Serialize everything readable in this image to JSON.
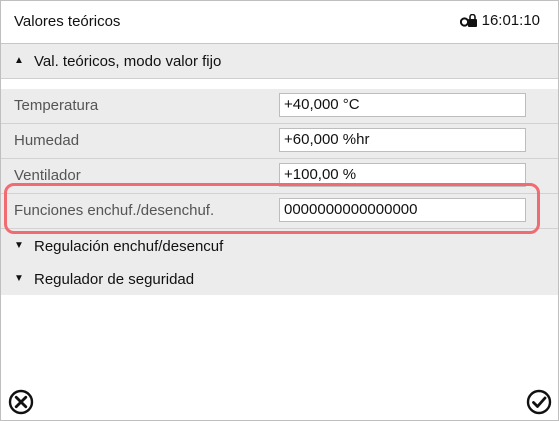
{
  "header": {
    "title": "Valores teóricos",
    "time": "16:01:10",
    "lock_icon": "lock-icon"
  },
  "sections": {
    "fixed_mode": {
      "label": "Val. teóricos, modo valor fijo",
      "state": "expanded"
    },
    "switch_regulation": {
      "label": "Regulación enchuf/desencuf",
      "state": "collapsed"
    },
    "safety_controller": {
      "label": "Regulador de seguridad",
      "state": "collapsed"
    }
  },
  "rows": [
    {
      "label": "Temperatura",
      "value": "+40,000 °C"
    },
    {
      "label": "Humedad",
      "value": "+60,000 %hr"
    },
    {
      "label": "Ventilador",
      "value": "+100,00 %"
    },
    {
      "label": "Funciones enchuf./desenchuf.",
      "value": "0000000000000000"
    }
  ],
  "footer": {
    "cancel_icon": "cancel-icon",
    "confirm_icon": "confirm-icon"
  },
  "colors": {
    "highlight": "#f06b72",
    "row_bg": "#ececec"
  }
}
